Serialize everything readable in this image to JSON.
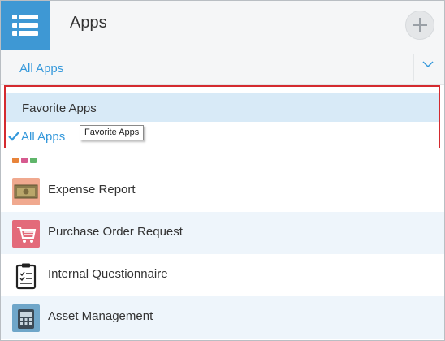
{
  "header": {
    "title": "Apps",
    "menu_icon": "menu-list-icon",
    "add_icon": "plus-icon"
  },
  "selector": {
    "value": "All Apps",
    "chevron_icon": "chevron-down-icon"
  },
  "dropdown": {
    "options": [
      {
        "label": "Favorite Apps",
        "highlighted": true,
        "checked": false
      },
      {
        "label": "All Apps",
        "highlighted": false,
        "checked": true
      }
    ],
    "tooltip": "Favorite Apps"
  },
  "apps": [
    {
      "name": "Expense Report",
      "icon": "money-icon"
    },
    {
      "name": "Purchase Order Request",
      "icon": "shopping-cart-icon"
    },
    {
      "name": "Internal Questionnaire",
      "icon": "clipboard-icon"
    },
    {
      "name": "Asset Management",
      "icon": "telephone-icon"
    }
  ],
  "colors": {
    "accent": "#3498db",
    "menu_tile": "#3e98d4",
    "highlight": "#d8eaf7",
    "outline": "#d42a2f"
  }
}
